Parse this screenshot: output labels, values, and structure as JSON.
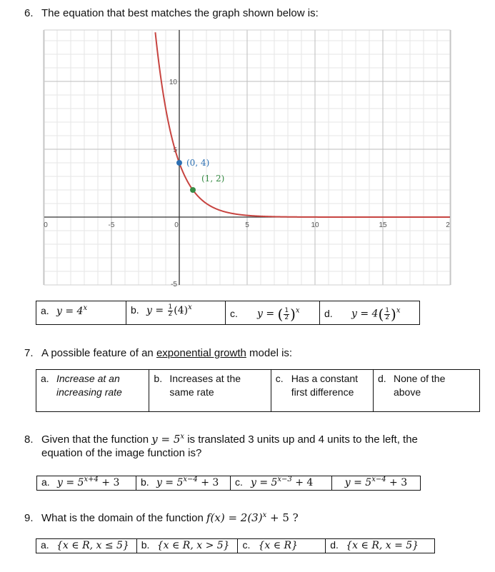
{
  "q6": {
    "number": "6.",
    "prompt": "The equation that best matches the graph shown below is:",
    "graph": {
      "x_tick_labels": [
        "0",
        "-5",
        "0",
        "5",
        "10",
        "15",
        "2"
      ],
      "y_tick_labels": [
        "10",
        "5",
        "-5"
      ],
      "points": [
        {
          "label": "(0, 4)",
          "x": 0,
          "y": 4,
          "color": "#2d70b3"
        },
        {
          "label": "(1, 2)",
          "x": 1,
          "y": 2,
          "color": "#388c46"
        }
      ],
      "curve_color": "#c74440",
      "curve_equation": "y = 4(1/2)^x"
    },
    "options": [
      {
        "letter": "a.",
        "base": "y = 4",
        "exp": "x"
      },
      {
        "letter": "b.",
        "pre": "y = ",
        "num": "1",
        "den": "2",
        "post": "(4)",
        "exp": "x"
      },
      {
        "letter": "c.",
        "pre": "y = ",
        "num": "1",
        "den": "2",
        "exp": "x"
      },
      {
        "letter": "d.",
        "pre": "y = 4",
        "num": "1",
        "den": "2",
        "exp": "x"
      }
    ]
  },
  "q7": {
    "number": "7.",
    "prompt_before": "A possible feature of an ",
    "prompt_underlined": "exponential growth",
    "prompt_after": " model is:",
    "options": [
      {
        "letter": "a.",
        "text": "Increase at an increasing rate"
      },
      {
        "letter": "b.",
        "text": "Increases at the same rate"
      },
      {
        "letter": "c.",
        "text": "Has a constant first difference"
      },
      {
        "letter": "d.",
        "text": "None of the above"
      }
    ]
  },
  "q8": {
    "number": "8.",
    "prompt_before": "Given that the function ",
    "prompt_math_base": "y = 5",
    "prompt_math_exp": "x",
    "prompt_after": " is translated 3 units up and 4 units to the left, the",
    "prompt_line2": "equation of the image function is?",
    "options": [
      {
        "letter": "a.",
        "base": "y = 5",
        "exp": "x+4",
        "tail": " + 3"
      },
      {
        "letter": "b.",
        "base": "y = 5",
        "exp": "x−4",
        "tail": " + 3"
      },
      {
        "letter": "c.",
        "base": "y = 5",
        "exp": "x−3",
        "tail": " + 4"
      },
      {
        "letter": "",
        "base": "y = 5",
        "exp": "x−4",
        "tail": " + 3"
      }
    ]
  },
  "q9": {
    "number": "9.",
    "prompt_before": "What is the domain of the function ",
    "prompt_math": "f(x) = 2(3)",
    "prompt_math_exp": "x",
    "prompt_math_tail": " + 5 ?",
    "options": [
      {
        "letter": "a.",
        "text": "{x ∈ R, x ≤ 5}"
      },
      {
        "letter": "b.",
        "text": "{x ∈ R, x > 5}"
      },
      {
        "letter": "c.",
        "text": "{x ∈ R}"
      },
      {
        "letter": "d.",
        "text": "{x ∈ R, x = 5}"
      }
    ]
  }
}
